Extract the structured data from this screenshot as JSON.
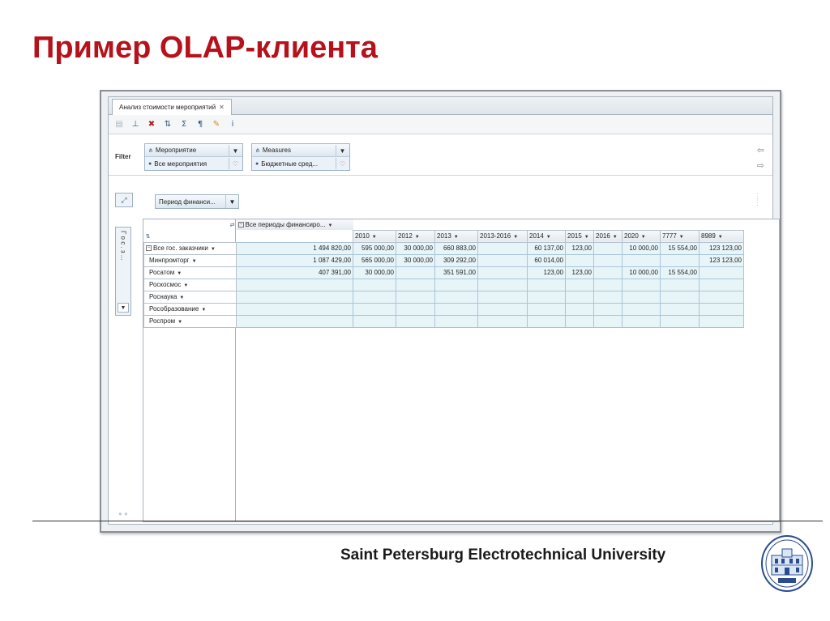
{
  "slide": {
    "title": "Пример OLAP-клиента",
    "footer": "Saint Petersburg Electrotechnical University"
  },
  "app": {
    "tab_label": "Анализ стоимости мероприятий",
    "toolbar_icons": [
      "save-icon",
      "hierarchy-icon",
      "filter-reset-icon",
      "sort-icon",
      "totals-icon",
      "format-icon",
      "paint-icon",
      "info-icon"
    ],
    "filters": {
      "label": "Filter",
      "items": [
        {
          "dimension": "Мероприятие",
          "value": "Все мероприятия"
        },
        {
          "dimension": "Measures",
          "value": "Бюджетные сред..."
        }
      ]
    },
    "column_chip": "Период финанси...",
    "row_panel_label": "Г о с . з ..."
  },
  "pivot": {
    "all_periods_label": "Все периоды финансиро...",
    "columns": [
      "2010",
      "2012",
      "2013",
      "2013-2016",
      "2014",
      "2015",
      "2016",
      "2020",
      "7777",
      "8989"
    ],
    "rows": [
      {
        "label": "Все гос. заказчики",
        "total": "1 494 820,00",
        "cells": [
          "595 000,00",
          "30 000,00",
          "660 883,00",
          "",
          "60 137,00",
          "123,00",
          "",
          "10 000,00",
          "15 554,00",
          "123 123,00"
        ]
      },
      {
        "label": "Минпромторг",
        "total": "1 087 429,00",
        "cells": [
          "565 000,00",
          "30 000,00",
          "309 292,00",
          "",
          "60 014,00",
          "",
          "",
          "",
          "",
          "123 123,00"
        ]
      },
      {
        "label": "Росатом",
        "total": "407 391,00",
        "cells": [
          "30 000,00",
          "",
          "351 591,00",
          "",
          "123,00",
          "123,00",
          "",
          "10 000,00",
          "15 554,00",
          ""
        ]
      },
      {
        "label": "Роскосмос",
        "total": "",
        "cells": [
          "",
          "",
          "",
          "",
          "",
          "",
          "",
          "",
          "",
          ""
        ]
      },
      {
        "label": "Роснаука",
        "total": "",
        "cells": [
          "",
          "",
          "",
          "",
          "",
          "",
          "",
          "",
          "",
          ""
        ]
      },
      {
        "label": "Рособразование",
        "total": "",
        "cells": [
          "",
          "",
          "",
          "",
          "",
          "",
          "",
          "",
          "",
          ""
        ]
      },
      {
        "label": "Роспром",
        "total": "",
        "cells": [
          "",
          "",
          "",
          "",
          "",
          "",
          "",
          "",
          "",
          ""
        ]
      }
    ]
  },
  "colors": {
    "title_red": "#b5121b",
    "cell_fill": "#e8f5f8",
    "grid_line": "#a9c4d8"
  }
}
